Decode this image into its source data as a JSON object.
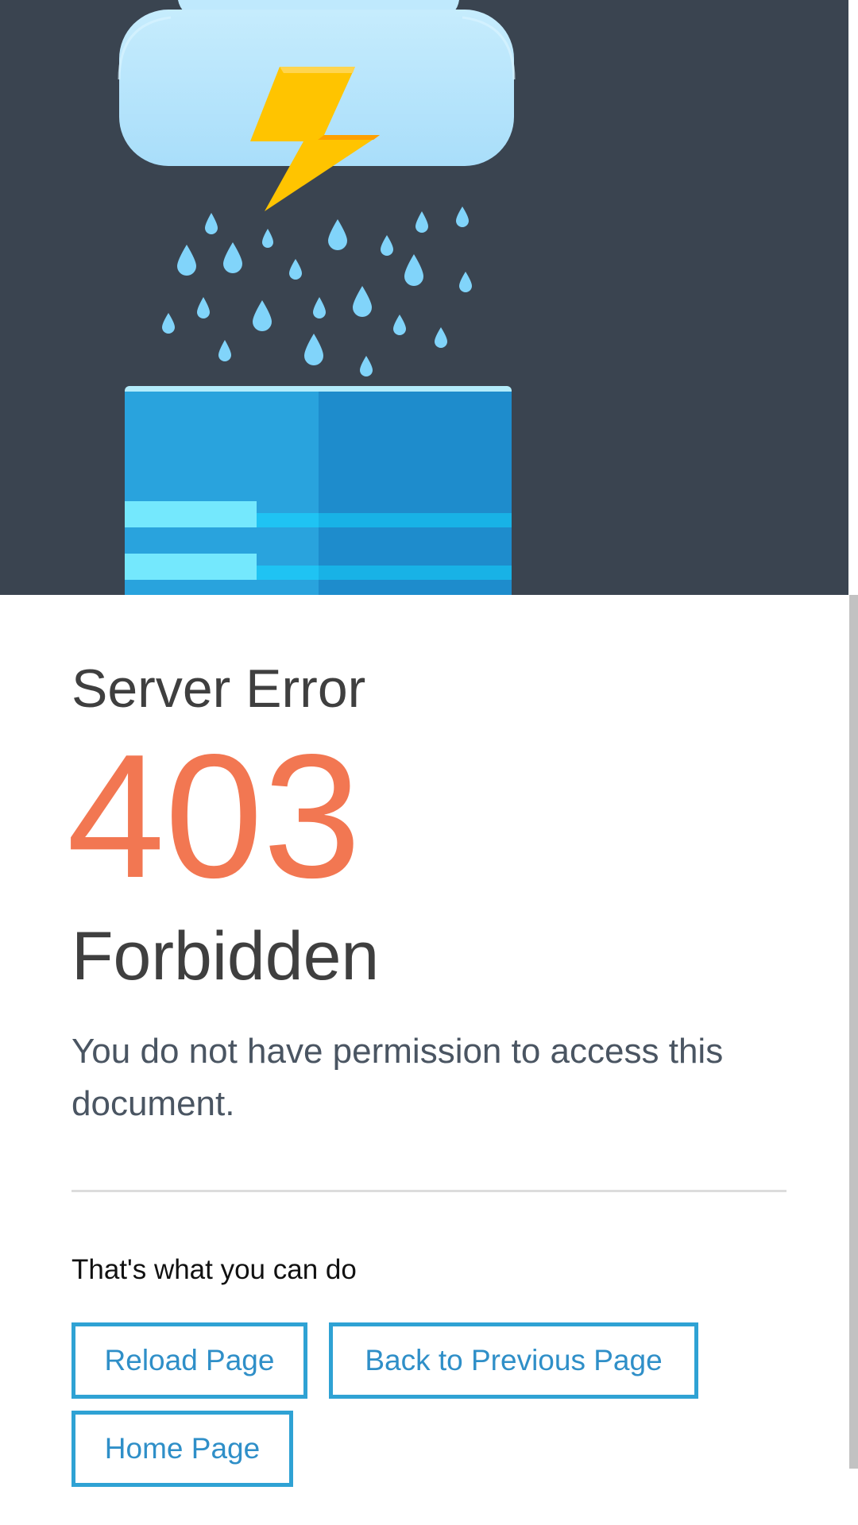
{
  "hero": {
    "illustration": "storm-cloud-over-server",
    "colors": {
      "background": "#3a4450",
      "cloud": "#b3e5fc",
      "lightning": "#ffc400",
      "rain": "#81d4fa",
      "server": "#29a3dd"
    }
  },
  "error": {
    "heading": "Server Error",
    "code": "403",
    "status": "Forbidden",
    "message": "You do not have permission to access this document.",
    "code_color": "#f27752"
  },
  "actions": {
    "title": "That's what you can do",
    "buttons": {
      "reload": "Reload Page",
      "back": "Back to Previous Page",
      "home": "Home Page"
    },
    "accent": "#2fa2d4"
  }
}
